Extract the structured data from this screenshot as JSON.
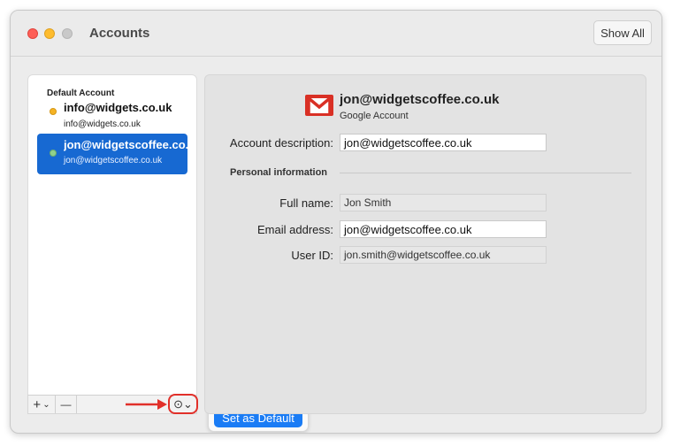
{
  "window": {
    "title": "Accounts",
    "show_all_label": "Show All"
  },
  "sidebar": {
    "default_label": "Default Account",
    "accounts": [
      {
        "name": "info@widgets.co.uk",
        "email": "info@widgets.co.uk",
        "status_color": "#f5b324",
        "selected": false
      },
      {
        "name": "jon@widgetscoffee.co.uk",
        "email": "jon@widgetscoffee.co.uk",
        "status_color": "#8fd08d",
        "selected": true
      }
    ],
    "add_label": "+",
    "add_menu": "⌄",
    "remove_label": "—",
    "more_label": "⊙⌄"
  },
  "popup": {
    "set_default_label": "Set as Default"
  },
  "detail": {
    "account_name": "jon@widgetscoffee.co.uk",
    "account_type": "Google Account",
    "account_description_label": "Account description:",
    "account_description_value": "jon@widgetscoffee.co.uk",
    "personal_info_title": "Personal information",
    "full_name_label": "Full name:",
    "full_name_value": "Jon Smith",
    "email_label": "Email address:",
    "email_value": "jon@widgetscoffee.co.uk",
    "user_id_label": "User ID:",
    "user_id_value": "jon.smith@widgetscoffee.co.uk"
  },
  "colors": {
    "accent": "#1769d2",
    "button_blue": "#1a7cf5",
    "highlight_red": "#e1302a"
  }
}
